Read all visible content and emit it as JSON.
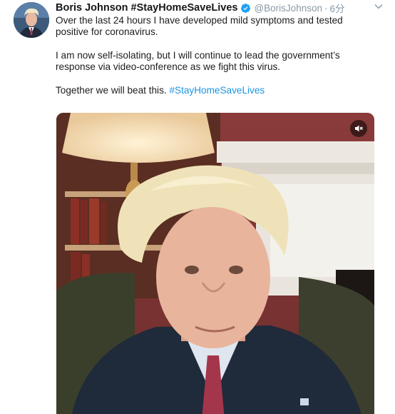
{
  "tweet": {
    "author": {
      "display_name": "Boris Johnson #StayHomeSaveLives",
      "handle": "@BorisJohnson",
      "separator": "·",
      "time": "6分",
      "verified": true
    },
    "text": {
      "line1": "Over the last 24 hours I have developed mild symptoms and tested positive for coronavirus.",
      "line2": "I am now self-isolating, but I will continue to lead the government’s response via video-conference as we fight this virus.",
      "line3_text": "Together we will beat this. ",
      "line3_hashtag": "#StayHomeSaveLives"
    },
    "media": {
      "type": "video",
      "muted": true
    },
    "icons": {
      "verified": "verified-badge-icon",
      "menu": "chevron-down-icon",
      "mute": "speaker-muted-icon"
    },
    "colors": {
      "hashtag": "#1b95e0",
      "verified": "#1da1f2",
      "secondary_text": "#8899a6"
    }
  }
}
